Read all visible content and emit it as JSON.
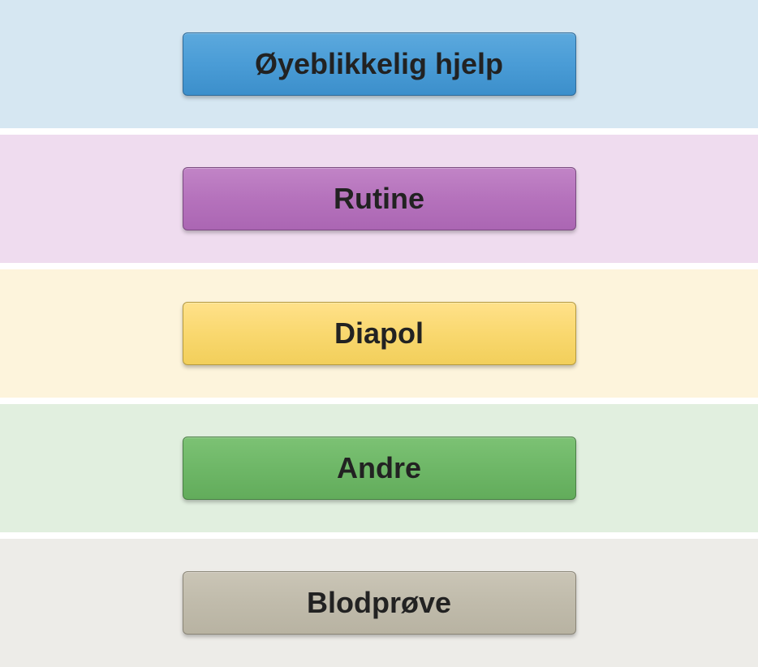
{
  "buttons": [
    {
      "label": "Øyeblikkelig hjelp",
      "row_color": "blue",
      "btn_color": "blue"
    },
    {
      "label": "Rutine",
      "row_color": "purple",
      "btn_color": "purple"
    },
    {
      "label": "Diapol",
      "row_color": "yellow",
      "btn_color": "yellow"
    },
    {
      "label": "Andre",
      "row_color": "green",
      "btn_color": "green"
    },
    {
      "label": "Blodprøve",
      "row_color": "gray",
      "btn_color": "gray"
    }
  ]
}
